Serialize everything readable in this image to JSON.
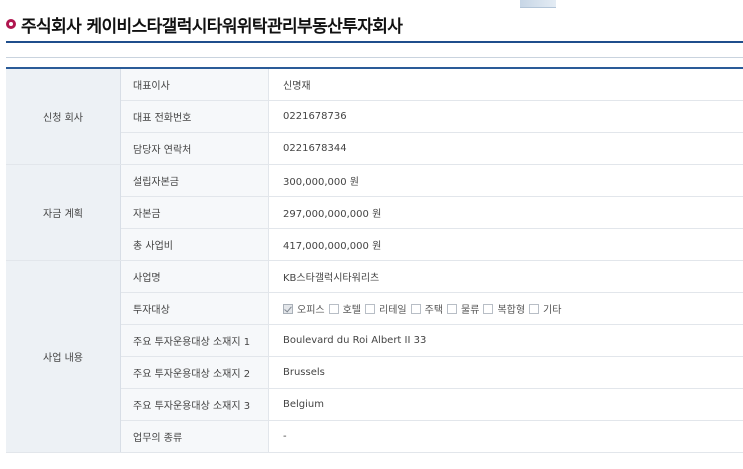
{
  "page": {
    "title": "주식회사 케이비스타갤럭시타워위탁관리부동산투자회사"
  },
  "groups": {
    "company": "신청 회사",
    "funding": "자금 계획",
    "business": "사업 내용"
  },
  "rows": {
    "ceo": {
      "label": "대표이사",
      "value": "신명재"
    },
    "phone": {
      "label": "대표 전화번호",
      "value": "0221678736"
    },
    "contact": {
      "label": "담당자 연락처",
      "value": "0221678344"
    },
    "capital_setup": {
      "label": "설립자본금",
      "value": "300,000,000 원"
    },
    "capital": {
      "label": "자본금",
      "value": "297,000,000,000 원"
    },
    "project_cost": {
      "label": "총 사업비",
      "value": "417,000,000,000 원"
    },
    "business_name": {
      "label": "사업명",
      "value": "KB스타갤럭시타워리츠"
    },
    "investment_target": {
      "label": "투자대상"
    },
    "location1": {
      "label": "주요 투자운용대상 소재지 1",
      "value": "Boulevard du Roi Albert II 33"
    },
    "location2": {
      "label": "주요 투자운용대상 소재지 2",
      "value": "Brussels"
    },
    "location3": {
      "label": "주요 투자운용대상 소재지 3",
      "value": "Belgium"
    },
    "business_type": {
      "label": "업무의 종류",
      "value": "-"
    }
  },
  "investment_options": [
    {
      "label": "오피스",
      "checked": true
    },
    {
      "label": "호텔",
      "checked": false
    },
    {
      "label": "리테일",
      "checked": false
    },
    {
      "label": "주택",
      "checked": false
    },
    {
      "label": "물류",
      "checked": false
    },
    {
      "label": "복합형",
      "checked": false
    },
    {
      "label": "기타",
      "checked": false
    }
  ],
  "colors": {
    "accent_bullet": "#b0164f",
    "header_rule": "#1f4e8c",
    "group_bg": "#edf1f5"
  }
}
